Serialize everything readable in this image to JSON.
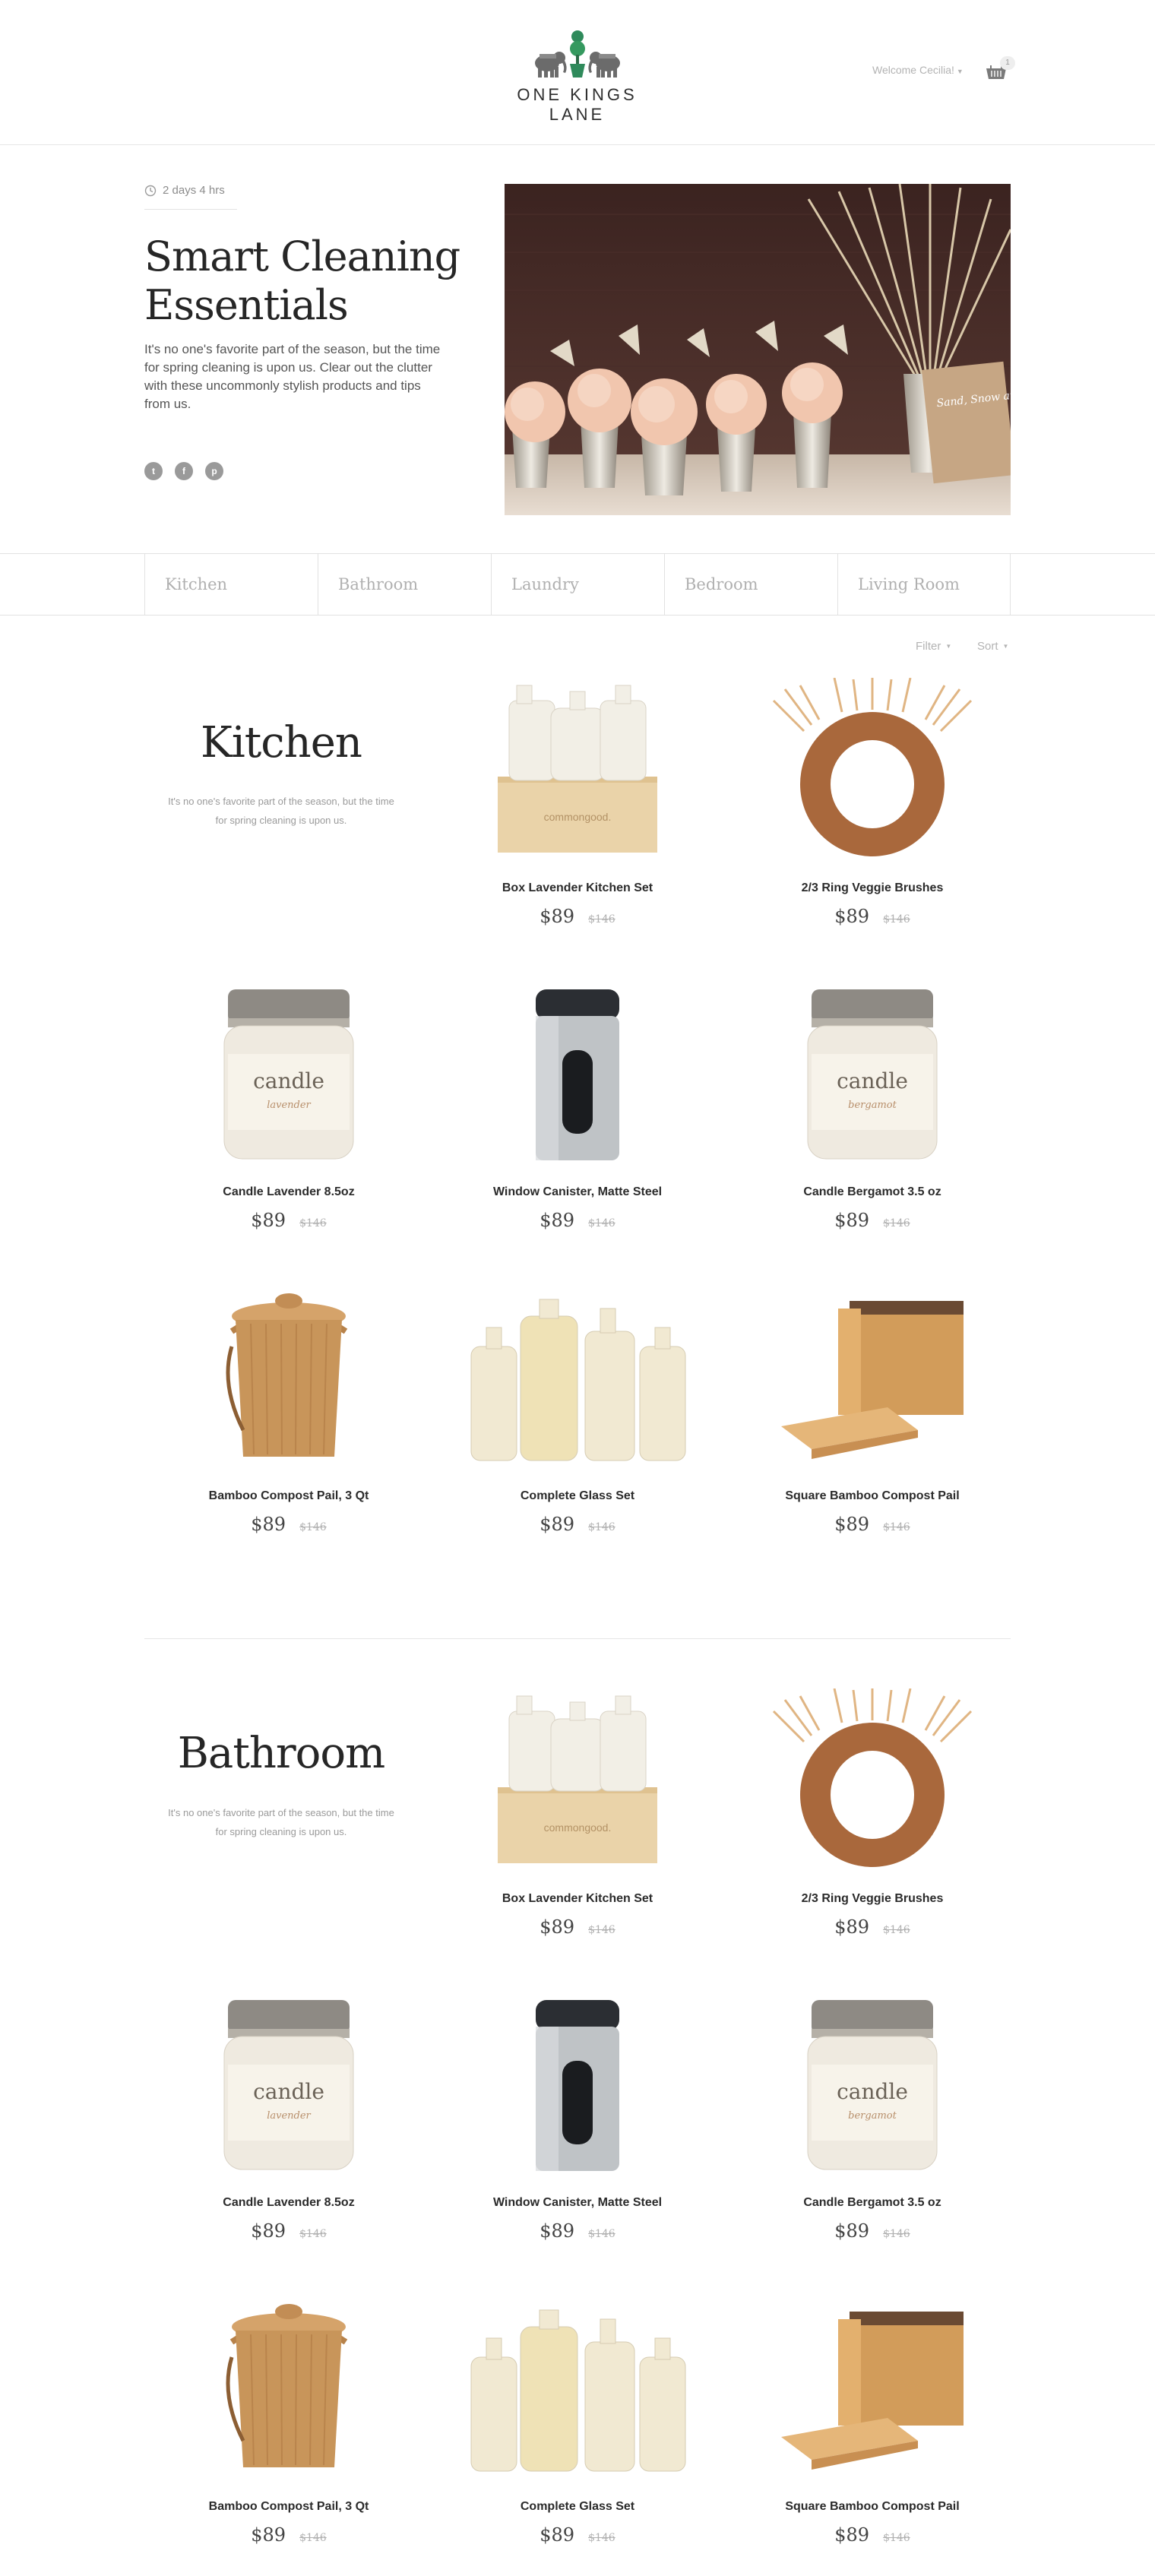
{
  "header": {
    "brand": "ONE KINGS LANE",
    "welcome": "Welcome Cecilia!",
    "cart_count": "1"
  },
  "hero": {
    "timer": "2 days 4 hrs",
    "title_line1": "Smart Cleaning",
    "title_line2": "Essentials",
    "description": "It's no one's favorite part of the season, but the time for spring cleaning is upon us. Clear out the clutter with these uncommonly stylish products and tips from us.",
    "photo_card_text": "Sand, Snow and Sun..."
  },
  "category_nav": [
    "Kitchen",
    "Bathroom",
    "Laundry",
    "Bedroom",
    "Living Room"
  ],
  "toolbar": {
    "filter": "Filter",
    "sort": "Sort"
  },
  "sections": [
    {
      "title": "Kitchen",
      "description": "It's no one's favorite part of the season, but the time for spring cleaning is upon us.",
      "products": [
        {
          "name": "Box Lavender Kitchen Set",
          "price": "$89",
          "orig": "$146",
          "icon": "kitchen-set-image"
        },
        {
          "name": "2/3 Ring Veggie Brushes",
          "price": "$89",
          "orig": "$146",
          "icon": "ring-brush-image"
        },
        {
          "name": "Candle Lavender 8.5oz",
          "price": "$89",
          "orig": "$146",
          "icon": "candle-image"
        },
        {
          "name": "Window Canister, Matte Steel",
          "price": "$89",
          "orig": "$146",
          "icon": "canister-image"
        },
        {
          "name": "Candle Bergamot 3.5 oz",
          "price": "$89",
          "orig": "$146",
          "icon": "candle-image"
        },
        {
          "name": "Bamboo Compost Pail, 3 Qt",
          "price": "$89",
          "orig": "$146",
          "icon": "compost-pail-image"
        },
        {
          "name": "Complete Glass Set",
          "price": "$89",
          "orig": "$146",
          "icon": "glass-set-image"
        },
        {
          "name": "Square Bamboo Compost Pail",
          "price": "$89",
          "orig": "$146",
          "icon": "square-pail-image"
        }
      ]
    },
    {
      "title": "Bathroom",
      "description": "It's no one's favorite part of the season, but the time for spring cleaning is upon us.",
      "products": [
        {
          "name": "Box Lavender Kitchen Set",
          "price": "$89",
          "orig": "$146",
          "icon": "kitchen-set-image"
        },
        {
          "name": "2/3 Ring Veggie Brushes",
          "price": "$89",
          "orig": "$146",
          "icon": "ring-brush-image"
        },
        {
          "name": "Candle Lavender 8.5oz",
          "price": "$89",
          "orig": "$146",
          "icon": "candle-image"
        },
        {
          "name": "Window Canister, Matte Steel",
          "price": "$89",
          "orig": "$146",
          "icon": "canister-image"
        },
        {
          "name": "Candle Bergamot 3.5 oz",
          "price": "$89",
          "orig": "$146",
          "icon": "candle-image"
        },
        {
          "name": "Bamboo Compost Pail, 3 Qt",
          "price": "$89",
          "orig": "$146",
          "icon": "compost-pail-image"
        },
        {
          "name": "Complete Glass Set",
          "price": "$89",
          "orig": "$146",
          "icon": "glass-set-image"
        },
        {
          "name": "Square Bamboo Compost Pail",
          "price": "$89",
          "orig": "$146",
          "icon": "square-pail-image"
        }
      ]
    }
  ],
  "product_labels": {
    "brand_on_box": "commongood.",
    "candle_word": "candle",
    "candle_scent_1": "lavender",
    "candle_scent_2": "bergamot"
  },
  "colors": {
    "text": "#262626",
    "muted": "#b0b0b0",
    "divider": "#e2e2e2",
    "hero_bg": "#3a1f1c",
    "bamboo": "#c8955a"
  }
}
